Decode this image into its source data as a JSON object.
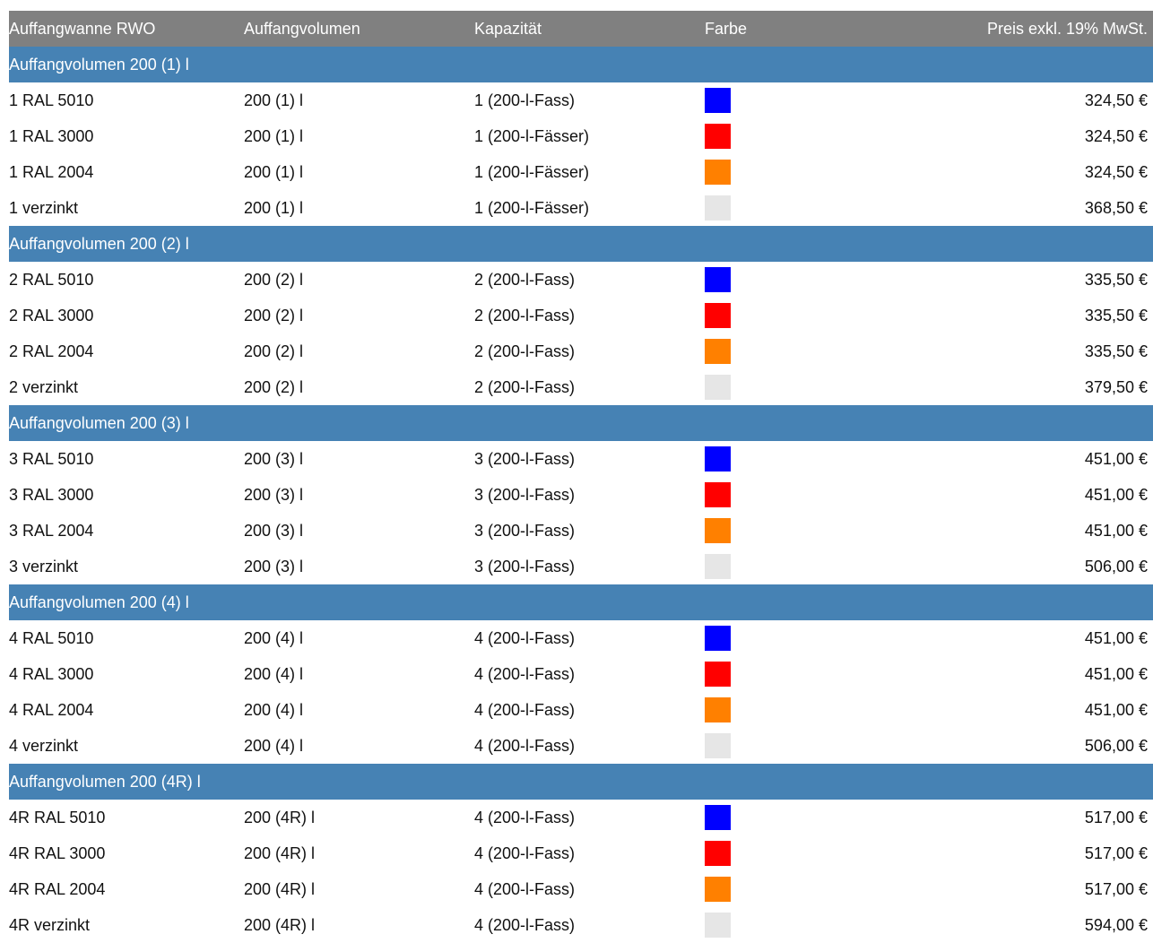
{
  "columns": [
    "Auffangwanne RWO",
    "Auffangvolumen",
    "Kapazität",
    "Farbe",
    "Preis exkl. 19% MwSt."
  ],
  "colors": {
    "header_bg": "#808080",
    "group_bg": "#4682b4",
    "blue": "#0000ff",
    "red": "#ff0000",
    "orange": "#ff8000",
    "verzinkt": "#e6e6e6"
  },
  "groups": [
    {
      "title": "Auffangvolumen 200 (1) l",
      "rows": [
        {
          "name": "1 RAL 5010",
          "volume": "200 (1) l",
          "capacity": "1 (200-l-Fass)",
          "color": "#0000ff",
          "price": "324,50 €"
        },
        {
          "name": "1 RAL 3000",
          "volume": "200 (1) l",
          "capacity": "1 (200-l-Fässer)",
          "color": "#ff0000",
          "price": "324,50 €"
        },
        {
          "name": "1 RAL 2004",
          "volume": "200 (1) l",
          "capacity": "1 (200-l-Fässer)",
          "color": "#ff8000",
          "price": "324,50 €"
        },
        {
          "name": "1 verzinkt",
          "volume": "200 (1) l",
          "capacity": "1 (200-l-Fässer)",
          "color": "#e6e6e6",
          "price": "368,50 €"
        }
      ]
    },
    {
      "title": "Auffangvolumen 200 (2) l",
      "rows": [
        {
          "name": "2 RAL 5010",
          "volume": "200 (2) l",
          "capacity": "2 (200-l-Fass)",
          "color": "#0000ff",
          "price": "335,50 €"
        },
        {
          "name": "2 RAL 3000",
          "volume": "200 (2) l",
          "capacity": "2 (200-l-Fass)",
          "color": "#ff0000",
          "price": "335,50 €"
        },
        {
          "name": "2 RAL 2004",
          "volume": "200 (2) l",
          "capacity": "2 (200-l-Fass)",
          "color": "#ff8000",
          "price": "335,50 €"
        },
        {
          "name": "2 verzinkt",
          "volume": "200 (2) l",
          "capacity": "2 (200-l-Fass)",
          "color": "#e6e6e6",
          "price": "379,50 €"
        }
      ]
    },
    {
      "title": "Auffangvolumen 200 (3) l",
      "rows": [
        {
          "name": "3 RAL 5010",
          "volume": "200 (3) l",
          "capacity": "3 (200-l-Fass)",
          "color": "#0000ff",
          "price": "451,00 €"
        },
        {
          "name": "3 RAL 3000",
          "volume": "200 (3) l",
          "capacity": "3 (200-l-Fass)",
          "color": "#ff0000",
          "price": "451,00 €"
        },
        {
          "name": "3 RAL 2004",
          "volume": "200 (3) l",
          "capacity": "3 (200-l-Fass)",
          "color": "#ff8000",
          "price": "451,00 €"
        },
        {
          "name": "3 verzinkt",
          "volume": "200 (3) l",
          "capacity": "3 (200-l-Fass)",
          "color": "#e6e6e6",
          "price": "506,00 €"
        }
      ]
    },
    {
      "title": "Auffangvolumen 200 (4) l",
      "rows": [
        {
          "name": "4 RAL 5010",
          "volume": "200 (4) l",
          "capacity": "4 (200-l-Fass)",
          "color": "#0000ff",
          "price": "451,00 €"
        },
        {
          "name": "4 RAL 3000",
          "volume": "200 (4) l",
          "capacity": "4 (200-l-Fass)",
          "color": "#ff0000",
          "price": "451,00 €"
        },
        {
          "name": "4 RAL 2004",
          "volume": "200 (4) l",
          "capacity": "4 (200-l-Fass)",
          "color": "#ff8000",
          "price": "451,00 €"
        },
        {
          "name": "4 verzinkt",
          "volume": "200 (4) l",
          "capacity": "4 (200-l-Fass)",
          "color": "#e6e6e6",
          "price": "506,00 €"
        }
      ]
    },
    {
      "title": "Auffangvolumen 200 (4R) l",
      "rows": [
        {
          "name": "4R RAL 5010",
          "volume": "200 (4R) l",
          "capacity": "4 (200-l-Fass)",
          "color": "#0000ff",
          "price": "517,00 €"
        },
        {
          "name": "4R RAL 3000",
          "volume": "200 (4R) l",
          "capacity": "4 (200-l-Fass)",
          "color": "#ff0000",
          "price": "517,00 €"
        },
        {
          "name": "4R RAL 2004",
          "volume": "200 (4R) l",
          "capacity": "4 (200-l-Fass)",
          "color": "#ff8000",
          "price": "517,00 €"
        },
        {
          "name": "4R verzinkt",
          "volume": "200 (4R) l",
          "capacity": "4 (200-l-Fass)",
          "color": "#e6e6e6",
          "price": "594,00 €"
        }
      ]
    }
  ]
}
